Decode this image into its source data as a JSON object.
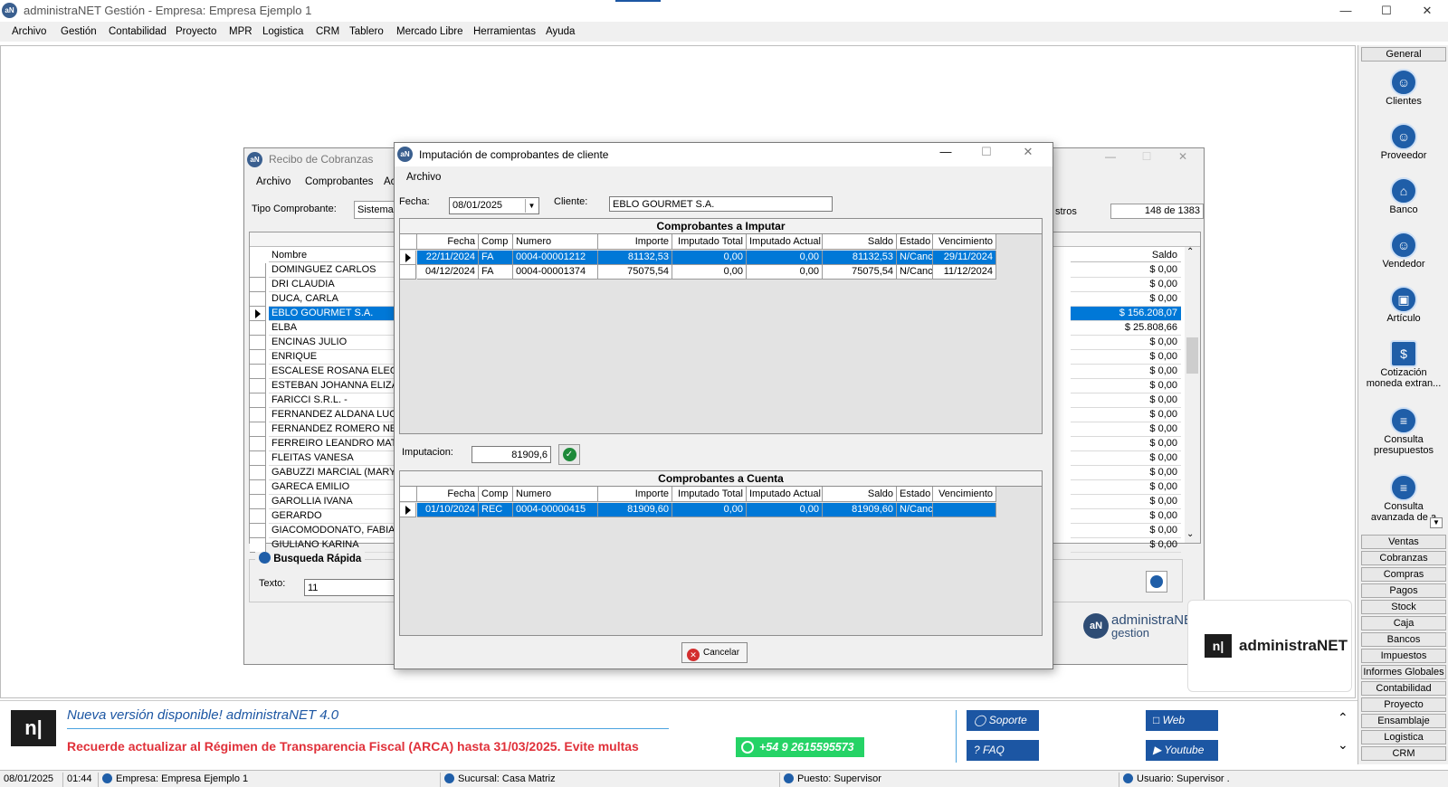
{
  "app": {
    "title": "administraNET Gestión - Empresa: Empresa Ejemplo 1",
    "logo": "aN",
    "min_label": "—",
    "max_label": "☐",
    "close_label": "✕"
  },
  "menu": [
    "Archivo",
    "Gestión",
    "Contabilidad",
    "Proyecto",
    "MPR",
    "Logistica",
    "CRM",
    "Tablero",
    "Mercado Libre",
    "Herramientas",
    "Ayuda"
  ],
  "right_panel": {
    "general_header": "General",
    "items": [
      {
        "label": "Clientes",
        "icon": "clients-icon",
        "glyph": "☺"
      },
      {
        "label": "Proveedor",
        "icon": "supplier-icon",
        "glyph": "☺"
      },
      {
        "label": "Banco",
        "icon": "bank-icon",
        "glyph": "⌂"
      },
      {
        "label": "Vendedor",
        "icon": "seller-icon",
        "glyph": "☺"
      },
      {
        "label": "Artículo",
        "icon": "box-icon",
        "glyph": "▣"
      },
      {
        "label": "Cotización",
        "label2": "moneda extran...",
        "icon": "currency-icon",
        "glyph": "$"
      },
      {
        "label": "Consulta",
        "label2": "presupuestos",
        "icon": "document-icon",
        "glyph": "≡"
      },
      {
        "label": "Consulta",
        "label2": "avanzada de a",
        "icon": "document-icon",
        "glyph": "≡"
      }
    ],
    "sections": [
      "Ventas",
      "Cobranzas",
      "Compras",
      "Pagos",
      "Stock",
      "Caja",
      "Bancos",
      "Impuestos",
      "Informes Globales",
      "Contabilidad",
      "Proyecto",
      "Ensamblaje",
      "Logistica",
      "CRM"
    ]
  },
  "recibo": {
    "title": "Recibo de Cobranzas",
    "menu": [
      "Archivo",
      "Comprobantes",
      "Ac"
    ],
    "tipo_label": "Tipo Comprobante:",
    "tipo_value": "Sistema",
    "registros_label": "stros",
    "registros_value": "148 de 1383",
    "col_nombre": "Nombre",
    "col_saldo": "Saldo",
    "rows": [
      {
        "nombre": "DOMINGUEZ CARLOS",
        "saldo": "$ 0,00"
      },
      {
        "nombre": "DRI CLAUDIA",
        "saldo": "$ 0,00"
      },
      {
        "nombre": "DUCA, CARLA",
        "saldo": "$ 0,00"
      },
      {
        "nombre": "EBLO GOURMET S.A.",
        "saldo": "$ 156.208,07",
        "selected": true
      },
      {
        "nombre": "ELBA",
        "saldo": "$ 25.808,66"
      },
      {
        "nombre": "ENCINAS JULIO",
        "saldo": "$ 0,00"
      },
      {
        "nombre": "ENRIQUE",
        "saldo": "$ 0,00"
      },
      {
        "nombre": "ESCALESE ROSANA ELEONO",
        "saldo": "$ 0,00"
      },
      {
        "nombre": "ESTEBAN JOHANNA ELIZABI",
        "saldo": "$ 0,00"
      },
      {
        "nombre": "FARICCI S.R.L. -",
        "saldo": "$ 0,00"
      },
      {
        "nombre": "FERNANDEZ ALDANA LUCILA",
        "saldo": "$ 0,00"
      },
      {
        "nombre": "FERNANDEZ ROMERO NERY",
        "saldo": "$ 0,00"
      },
      {
        "nombre": "FERREIRO LEANDRO MATIAS",
        "saldo": "$ 0,00"
      },
      {
        "nombre": "FLEITAS VANESA",
        "saldo": "$ 0,00"
      },
      {
        "nombre": "GABUZZI MARCIAL (MARY)",
        "saldo": "$ 0,00"
      },
      {
        "nombre": "GARECA EMILIO",
        "saldo": "$ 0,00"
      },
      {
        "nombre": "GAROLLIA IVANA",
        "saldo": "$ 0,00"
      },
      {
        "nombre": "GERARDO",
        "saldo": "$ 0,00"
      },
      {
        "nombre": "GIACOMODONATO, FABIANA",
        "saldo": "$ 0,00"
      },
      {
        "nombre": "GIULIANO KARINA",
        "saldo": "$ 0,00"
      }
    ],
    "busqueda_title": "Busqueda Rápida",
    "texto_label": "Texto:",
    "texto_value": "11",
    "brand_text1": "administraNET",
    "brand_text2": "gestion",
    "brand_text3": "administraNET",
    "brand_logo": "aN",
    "brand_logo2": "n|"
  },
  "dialog": {
    "title": "Imputación de comprobantes de cliente",
    "logo": "aN",
    "menu_archivo": "Archivo",
    "fecha_label": "Fecha:",
    "fecha_value": "08/01/2025",
    "cliente_label": "Cliente:",
    "cliente_value": "EBLO GOURMET S.A.",
    "t1": {
      "title": "Comprobantes a Imputar",
      "columns": [
        "Fecha",
        "Comp",
        "Numero",
        "Importe",
        "Imputado Total",
        "Imputado Actual",
        "Saldo",
        "Estado",
        "Vencimiento"
      ],
      "rows": [
        [
          "22/11/2024",
          "FA",
          "0004-00001212",
          "81132,53",
          "0,00",
          "0,00",
          "81132,53",
          "N/Canc",
          "29/11/2024"
        ],
        [
          "04/12/2024",
          "FA",
          "0004-00001374",
          "75075,54",
          "0,00",
          "0,00",
          "75075,54",
          "N/Canc",
          "11/12/2024"
        ]
      ]
    },
    "imputacion_label": "Imputacion:",
    "imputacion_value": "81909,6",
    "t2": {
      "title": "Comprobantes a Cuenta",
      "columns": [
        "Fecha",
        "Comp",
        "Numero",
        "Importe",
        "Imputado Total",
        "Imputado Actual",
        "Saldo",
        "Estado",
        "Vencimiento"
      ],
      "rows": [
        [
          "01/10/2024",
          "REC",
          "0004-00000415",
          "81909,60",
          "0,00",
          "0,00",
          "81909,60",
          "N/Canc",
          ""
        ]
      ]
    },
    "cancel_label": "Cancelar"
  },
  "banner": {
    "headline": "Nueva versión disponible! administraNET 4.0",
    "notice": "Recuerde actualizar al Régimen de Transparencia Fiscal (ARCA) hasta 31/03/2025. Evite multas",
    "whatsapp": "+54 9 2615595573",
    "soporte": "Soporte",
    "faq": "FAQ",
    "web": "Web",
    "youtube": "Youtube",
    "logo": "n|"
  },
  "statusbar": {
    "fecha": "08/01/2025",
    "hora": "01:44",
    "empresa": "Empresa: Empresa Ejemplo 1",
    "sucursal": "Sucursal: Casa Matriz",
    "puesto": "Puesto: Supervisor",
    "usuario": "Usuario: Supervisor ."
  },
  "colors": {
    "selection": "#0078d7",
    "accent": "#1c56a3",
    "whatsapp": "#25d366",
    "notice": "#e0313a"
  }
}
